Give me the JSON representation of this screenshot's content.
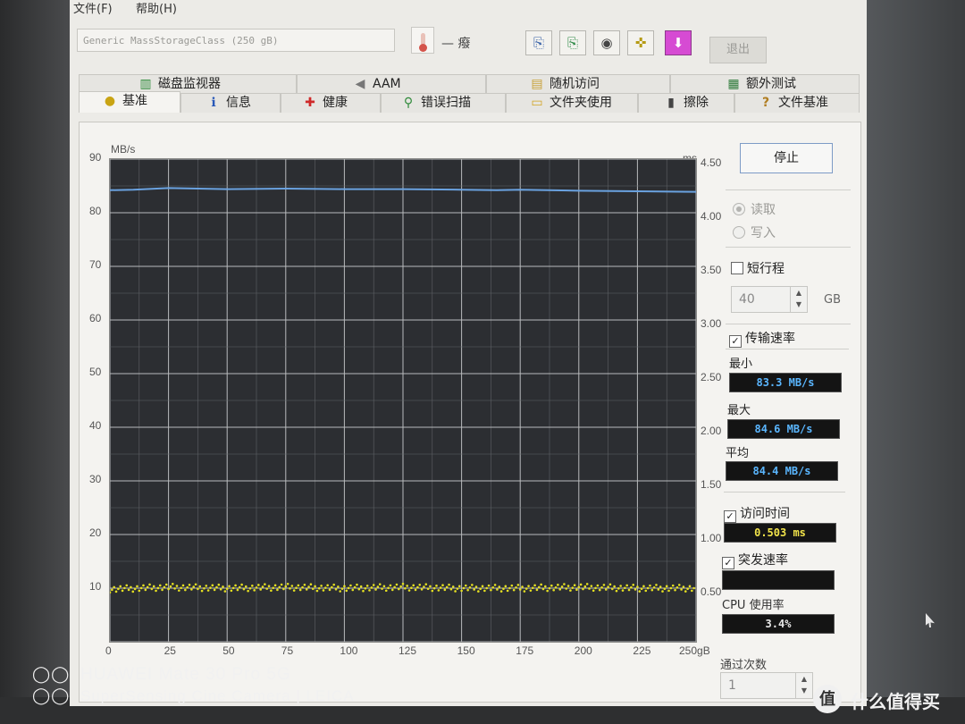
{
  "menu": {
    "file": "文件(F)",
    "help": "帮助(H)"
  },
  "toolbar": {
    "drive": "Generic MassStorageClass (250 gB)",
    "temperature": "— 癈",
    "buttons": [
      {
        "icon": "copy-text-icon",
        "glyph": "⎘"
      },
      {
        "icon": "copy-screenshot-icon",
        "glyph": "⎘"
      },
      {
        "icon": "camera-icon",
        "glyph": "◉"
      },
      {
        "icon": "tools-icon",
        "glyph": "✜"
      },
      {
        "icon": "download-arrow-icon",
        "glyph": "⬇"
      }
    ],
    "exit": "退出"
  },
  "tabs_top": [
    {
      "label": "磁盘监视器",
      "icon": "bar-chart-icon",
      "glyph": "▥"
    },
    {
      "label": "AAM",
      "icon": "speaker-icon",
      "glyph": "◀"
    },
    {
      "label": "随机访问",
      "icon": "chart-icon",
      "glyph": "▤"
    },
    {
      "label": "额外测试",
      "icon": "chart-icon",
      "glyph": "▦"
    }
  ],
  "tabs_bottom": [
    {
      "label": "基准",
      "icon": "lightbulb-icon",
      "glyph": "💡"
    },
    {
      "label": "信息",
      "icon": "info-icon",
      "glyph": "ℹ"
    },
    {
      "label": "健康",
      "icon": "plus-icon",
      "glyph": "✚"
    },
    {
      "label": "错误扫描",
      "icon": "magnifier-icon",
      "glyph": "⚲"
    },
    {
      "label": "文件夹使用",
      "icon": "folder-icon",
      "glyph": "▭"
    },
    {
      "label": "擦除",
      "icon": "trash-icon",
      "glyph": "▮"
    },
    {
      "label": "文件基准",
      "icon": "help-icon",
      "glyph": "?"
    }
  ],
  "chart_data": {
    "type": "line",
    "y_left_unit": "MB/s",
    "y_right_unit": "ms",
    "x_unit": "gB",
    "y_left_ticks": [
      "90",
      "80",
      "70",
      "60",
      "50",
      "40",
      "30",
      "20",
      "10"
    ],
    "y_right_ticks": [
      "4.50",
      "4.00",
      "3.50",
      "3.00",
      "2.50",
      "2.00",
      "1.50",
      "1.00",
      "0.50"
    ],
    "x_ticks": [
      "0",
      "25",
      "50",
      "75",
      "100",
      "125",
      "150",
      "175",
      "200",
      "225",
      "250gB"
    ],
    "xlim": [
      0,
      250
    ],
    "ylim": [
      0,
      90
    ],
    "y2lim": [
      0,
      4.5
    ],
    "grid": true,
    "series": [
      {
        "axis": "left",
        "color": "#6aa2e0",
        "x": [
          0,
          10,
          25,
          50,
          75,
          100,
          125,
          150,
          165,
          175,
          200,
          225,
          250
        ],
        "values": [
          84.2,
          84.3,
          84.6,
          84.4,
          84.5,
          84.4,
          84.4,
          84.3,
          84.2,
          84.3,
          84.1,
          84.0,
          83.9
        ]
      },
      {
        "axis": "right",
        "color": "#e5e021",
        "x": [
          0,
          25,
          50,
          75,
          100,
          125,
          150,
          175,
          200,
          225,
          250
        ],
        "values": [
          0.49,
          0.51,
          0.5,
          0.51,
          0.5,
          0.51,
          0.5,
          0.5,
          0.51,
          0.5,
          0.5
        ]
      }
    ]
  },
  "side": {
    "stop": "停止",
    "read": "读取",
    "write": "写入",
    "short_stroke": "短行程",
    "short_value": "40",
    "short_unit": "GB",
    "transfer_rate": "传输速率",
    "min_label": "最小",
    "min_value": "83.3 MB/s",
    "max_label": "最大",
    "max_value": "84.6 MB/s",
    "avg_label": "平均",
    "avg_value": "84.4 MB/s",
    "access_time": "访问时间",
    "access_value": "0.503 ms",
    "burst_rate": "突发速率",
    "burst_value": "",
    "cpu_label": "CPU 使用率",
    "cpu_value": "3.4%",
    "passes_label": "通过次数",
    "passes_value": "1",
    "lcd_color": "#5ab6ff",
    "lcd_color_access": "#f1e34a"
  },
  "watermark": {
    "line1": "HUAWEI Mate 30 Pro 5G",
    "line2": "SuperSensing Cine Camera | LEICA",
    "site_icon": "zhi-logo-icon",
    "site": "什么值得买"
  }
}
